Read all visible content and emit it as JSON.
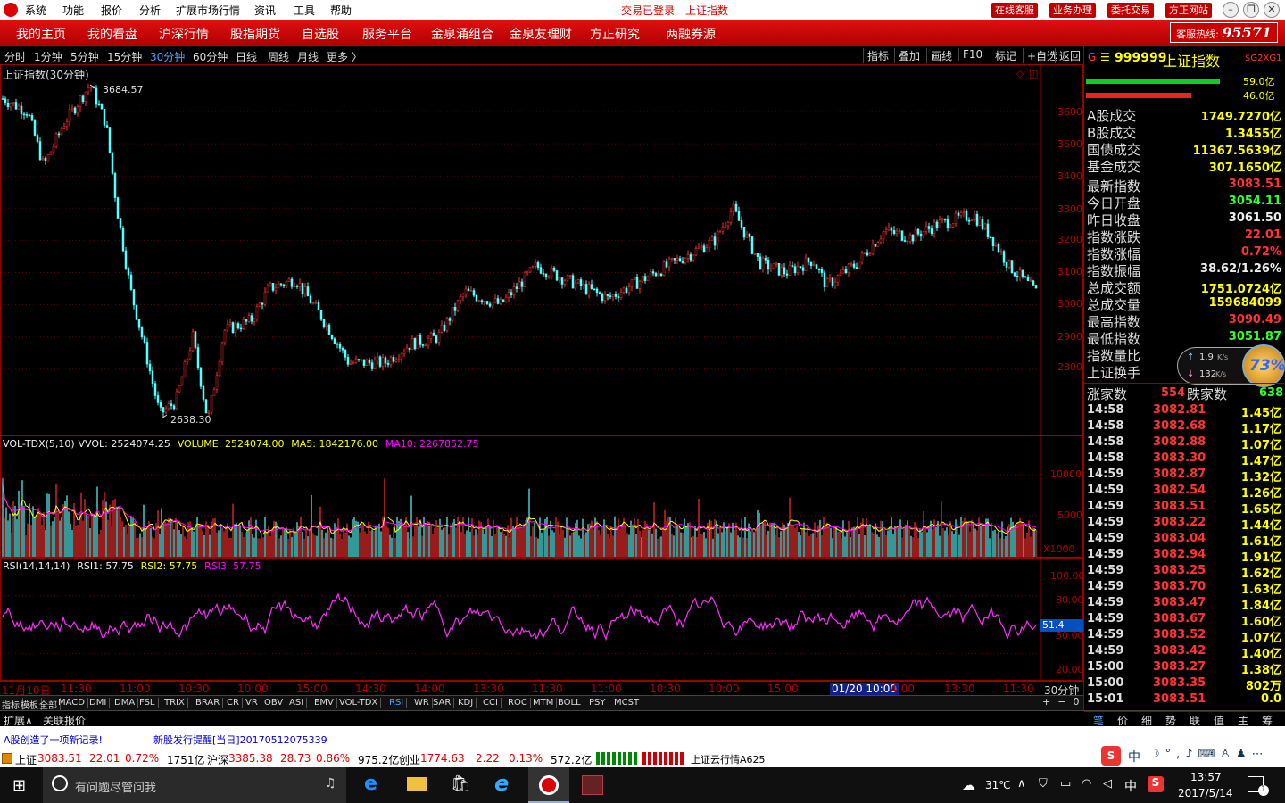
{
  "titlebar": {
    "menus": [
      "系统",
      "功能",
      "报价",
      "分析",
      "扩展市场行情",
      "资讯",
      "工具",
      "帮助"
    ],
    "login_status": "交易已登录",
    "center_title": "上证指数",
    "buttons": [
      "在线客服",
      "业务办理",
      "委托交易",
      "方正网站"
    ]
  },
  "navbar": {
    "items": [
      "我的主页",
      "我的看盘",
      "沪深行情",
      "股指期货",
      "自选股",
      "服务平台",
      "金泉涌组合",
      "金泉友理财",
      "方正研究",
      "两融券源"
    ],
    "hotline_label": "客服热线:",
    "hotline_number": "95571"
  },
  "periods": {
    "items": [
      "分时",
      "1分钟",
      "5分钟",
      "15分钟",
      "30分钟",
      "60分钟",
      "日线",
      "周线",
      "月线",
      "更多 〉"
    ],
    "active_index": 4
  },
  "tools": [
    "指标",
    "叠加",
    "画线",
    "F10",
    "标记",
    "+自选",
    "返回"
  ],
  "kline": {
    "title": "上证指数(30分钟)",
    "high_label": "3684.57",
    "low_label": "2638.30",
    "price_axis": [
      "3600",
      "3500",
      "3400",
      "3300",
      "3200",
      "3100",
      "3000",
      "2900",
      "2800"
    ]
  },
  "vol": {
    "name": "VOL-TDX(5,10)",
    "vvol": "VVOL: 2524074.25",
    "volume": "VOLUME: 2524074.00",
    "ma5": "MA5: 1842176.00",
    "ma10": "MA10: 2267852.75",
    "axis": [
      "10000",
      "5000"
    ],
    "unit": "X1000"
  },
  "rsi": {
    "name": "RSI(14,14,14)",
    "rsi1": "RSI1: 57.75",
    "rsi2": "RSI2: 57.75",
    "rsi3": "RSI3: 57.75",
    "axis": [
      "100.00",
      "80.00",
      "50.00",
      "20.00"
    ],
    "current": "51.4"
  },
  "timeaxis": {
    "labels": [
      "11月10日",
      "11:30",
      "11:00",
      "10:30",
      "10:00",
      "15:00",
      "14:30",
      "14:00",
      "13:30",
      "11:30",
      "11:00",
      "10:30",
      "10:00",
      "15:00"
    ],
    "cursor": "01/20 10:00",
    "cursor_tail": "4:00",
    "tail": [
      "13:30",
      "11:30"
    ],
    "period": "30分钟"
  },
  "indicator_tabs": [
    "指标",
    "模板",
    "全部",
    "MACD",
    "DMI",
    "DMA",
    "FSL",
    "TRIX",
    "BRAR",
    "CR",
    "VR",
    "OBV",
    "ASI",
    "EMV",
    "VOL-TDX",
    "RSI",
    "WR",
    "SAR",
    "KDJ",
    "CCI",
    "ROC",
    "MTM",
    "BOLL",
    "PSY",
    "MCST"
  ],
  "indicator_active": "RSI",
  "bottom_tabs": [
    "扩展∧",
    "关联报价"
  ],
  "right": {
    "code": "999999",
    "name": "上证指数",
    "badge": "$G2XG1",
    "bar1_pct": "59.0亿",
    "bar2_pct": "46.0亿",
    "stats": [
      {
        "k": "A股成交",
        "v": "1749.7270亿",
        "c": "yellow"
      },
      {
        "k": "B股成交",
        "v": "1.3455亿",
        "c": "yellow"
      },
      {
        "k": "国债成交",
        "v": "11367.5639亿",
        "c": "yellow"
      },
      {
        "k": "基金成交",
        "v": "307.1650亿",
        "c": "yellow"
      }
    ],
    "quotes": [
      {
        "k": "最新指数",
        "v": "3083.51",
        "c": "red"
      },
      {
        "k": "今日开盘",
        "v": "3054.11",
        "c": "green"
      },
      {
        "k": "昨日收盘",
        "v": "3061.50",
        "c": "white"
      },
      {
        "k": "指数涨跌",
        "v": "22.01",
        "c": "red"
      },
      {
        "k": "指数涨幅",
        "v": "0.72%",
        "c": "red"
      },
      {
        "k": "指数振幅",
        "v": "38.62/1.26%",
        "c": "white"
      },
      {
        "k": "总成交额",
        "v": "1751.0724亿",
        "c": "yellow"
      },
      {
        "k": "总成交量",
        "v": "159684099",
        "c": "yellow"
      },
      {
        "k": "最高指数",
        "v": "3090.49",
        "c": "red"
      },
      {
        "k": "最低指数",
        "v": "3051.87",
        "c": "green"
      },
      {
        "k": "指数量比",
        "v": "",
        "c": "white"
      },
      {
        "k": "上证换手",
        "v": "",
        "c": "white"
      }
    ],
    "net_up_label": "1.9",
    "net_down_label": "132",
    "net_unit": "K/s",
    "net_pct": "73%",
    "up_label": "涨家数",
    "up_value": "554",
    "down_label": "跌家数",
    "down_value": "638",
    "ticks": [
      {
        "t": "14:58",
        "p": "3082.81",
        "a": "1.45亿"
      },
      {
        "t": "14:58",
        "p": "3082.68",
        "a": "1.17亿"
      },
      {
        "t": "14:58",
        "p": "3082.88",
        "a": "1.07亿"
      },
      {
        "t": "14:58",
        "p": "3083.30",
        "a": "1.47亿"
      },
      {
        "t": "14:59",
        "p": "3082.87",
        "a": "1.32亿"
      },
      {
        "t": "14:59",
        "p": "3082.54",
        "a": "1.26亿"
      },
      {
        "t": "14:59",
        "p": "3083.51",
        "a": "1.65亿"
      },
      {
        "t": "14:59",
        "p": "3083.22",
        "a": "1.44亿"
      },
      {
        "t": "14:59",
        "p": "3083.04",
        "a": "1.61亿"
      },
      {
        "t": "14:59",
        "p": "3082.94",
        "a": "1.91亿"
      },
      {
        "t": "14:59",
        "p": "3083.25",
        "a": "1.62亿"
      },
      {
        "t": "14:59",
        "p": "3083.70",
        "a": "1.63亿"
      },
      {
        "t": "14:59",
        "p": "3083.47",
        "a": "1.84亿"
      },
      {
        "t": "14:59",
        "p": "3083.67",
        "a": "1.60亿"
      },
      {
        "t": "14:59",
        "p": "3083.52",
        "a": "1.07亿"
      },
      {
        "t": "14:59",
        "p": "3083.42",
        "a": "1.40亿"
      },
      {
        "t": "15:00",
        "p": "3083.27",
        "a": "1.38亿"
      },
      {
        "t": "15:00",
        "p": "3083.35",
        "a": "802万"
      },
      {
        "t": "15:01",
        "p": "3083.51",
        "a": "0.0"
      }
    ],
    "tabs": [
      "笔",
      "价",
      "细",
      "势",
      "联",
      "值",
      "主",
      "筹"
    ]
  },
  "news": {
    "left": "A股创造了一项新记录!",
    "right": "新股发行提醒[当日]20170512075339"
  },
  "status": {
    "sh_label": "上证",
    "sh_price": "3083.51",
    "sh_chg": "22.01",
    "sh_pct": "0.72%",
    "sh_amt": "1751亿",
    "hs_label": "沪深",
    "hs_price": "3385.38",
    "hs_chg": "28.73",
    "hs_pct": "0.86%",
    "hs_amt": "975.2亿",
    "cy_label": "创业",
    "cy_price": "1774.63",
    "cy_chg": "2.22",
    "cy_pct": "0.13%",
    "cy_amt": "572.2亿",
    "cloud": "上证云行情A625"
  },
  "ime": "中",
  "taskbar": {
    "search": "有问题尽管问我",
    "temp": "31℃",
    "lang": "中",
    "time": "13:57",
    "date": "2017/5/14",
    "notif": "1"
  }
}
